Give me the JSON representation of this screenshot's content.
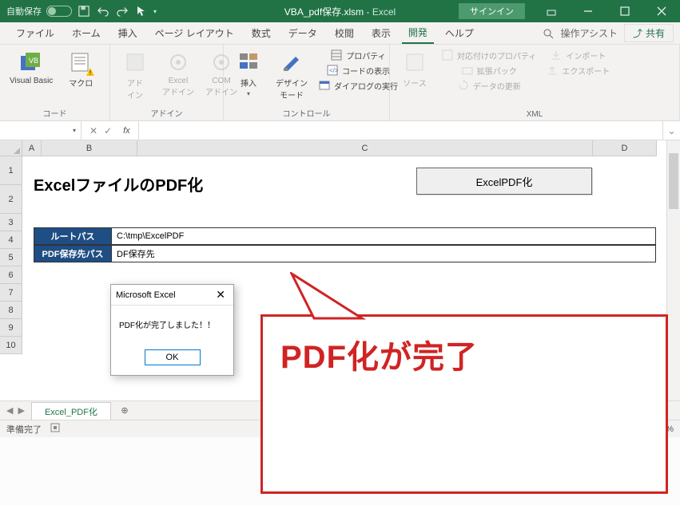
{
  "titlebar": {
    "autosave_label": "自動保存",
    "filename": "VBA_pdf保存.xlsm",
    "app_suffix": " - Excel",
    "signin": "サインイン"
  },
  "tabs": {
    "file": "ファイル",
    "home": "ホーム",
    "insert": "挿入",
    "pagelayout": "ページ レイアウト",
    "formulas": "数式",
    "data": "データ",
    "review": "校閲",
    "view": "表示",
    "developer": "開発",
    "help": "ヘルプ",
    "tellme": "操作アシスト",
    "share": "共有"
  },
  "ribbon": {
    "code_group": "コード",
    "addins_group": "アドイン",
    "controls_group": "コントロール",
    "xml_group": "XML",
    "visual_basic": "Visual Basic",
    "macros": "マクロ",
    "addins": "アド\nイン",
    "excel_addins": "Excel\nアドイン",
    "com_addins": "COM\nアドイン",
    "insert": "挿入",
    "design_mode": "デザイン\nモード",
    "properties": "プロパティ",
    "view_code": "コードの表示",
    "run_dialog": "ダイアログの実行",
    "source": "ソース",
    "map_properties": "対応付けのプロパティ",
    "expansion_packs": "拡張パック",
    "refresh_data": "データの更新",
    "import": "インポート",
    "export": "エクスポート"
  },
  "formula_bar": {
    "namebox": "",
    "fx": "fx"
  },
  "columns": {
    "A": "A",
    "B": "B",
    "C": "C",
    "D": "D"
  },
  "rows": [
    "1",
    "2",
    "3",
    "4",
    "5",
    "6",
    "7",
    "8",
    "9",
    "10"
  ],
  "sheet": {
    "heading": "ExcelファイルのPDF化",
    "button": "ExcelPDF化",
    "row1_label": "ルートパス",
    "row1_value": "C:\\tmp\\ExcelPDF",
    "row2_label": "PDF保存先パス",
    "row2_value": "DF保存先"
  },
  "dialog": {
    "title": "Microsoft Excel",
    "message": "PDF化が完了しました！！",
    "ok": "OK"
  },
  "sheettabs": {
    "tab1": "Excel_PDF化"
  },
  "statusbar": {
    "ready": "準備完了",
    "zoom": "%"
  },
  "callout": {
    "text": "PDF化が完了"
  }
}
